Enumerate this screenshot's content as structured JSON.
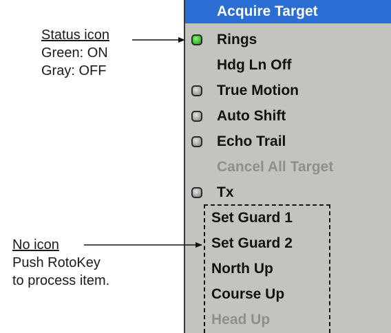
{
  "annotations": {
    "status": {
      "title": "Status icon",
      "lines": [
        "Green: ON",
        "Gray: OFF"
      ]
    },
    "no_icon": {
      "title": "No icon",
      "lines": [
        "Push RotoKey",
        "to process item."
      ]
    }
  },
  "menu": {
    "header": "Acquire Target",
    "items": [
      {
        "label": "Rings",
        "icon": "green",
        "enabled": true
      },
      {
        "label": "Hdg Ln Off",
        "icon": "none",
        "enabled": true
      },
      {
        "label": "True Motion",
        "icon": "gray",
        "enabled": true
      },
      {
        "label": "Auto Shift",
        "icon": "gray",
        "enabled": true
      },
      {
        "label": "Echo Trail",
        "icon": "gray",
        "enabled": true
      },
      {
        "label": "Cancel All Target",
        "icon": "none",
        "enabled": false
      },
      {
        "label": "Tx",
        "icon": "gray",
        "enabled": true
      },
      {
        "label": "Set Guard 1",
        "icon": "none",
        "enabled": true
      },
      {
        "label": "Set Guard 2",
        "icon": "none",
        "enabled": true
      },
      {
        "label": "North Up",
        "icon": "none",
        "enabled": true
      },
      {
        "label": "Course Up",
        "icon": "none",
        "enabled": true
      },
      {
        "label": "Head Up",
        "icon": "none",
        "enabled": false
      }
    ]
  },
  "colors": {
    "header_bg": "#2a6ed4",
    "menu_bg": "#c4c4bf",
    "status_on": "#3fbf35",
    "status_off": "#a9a9a9",
    "disabled_text": "#8e8e8e"
  }
}
